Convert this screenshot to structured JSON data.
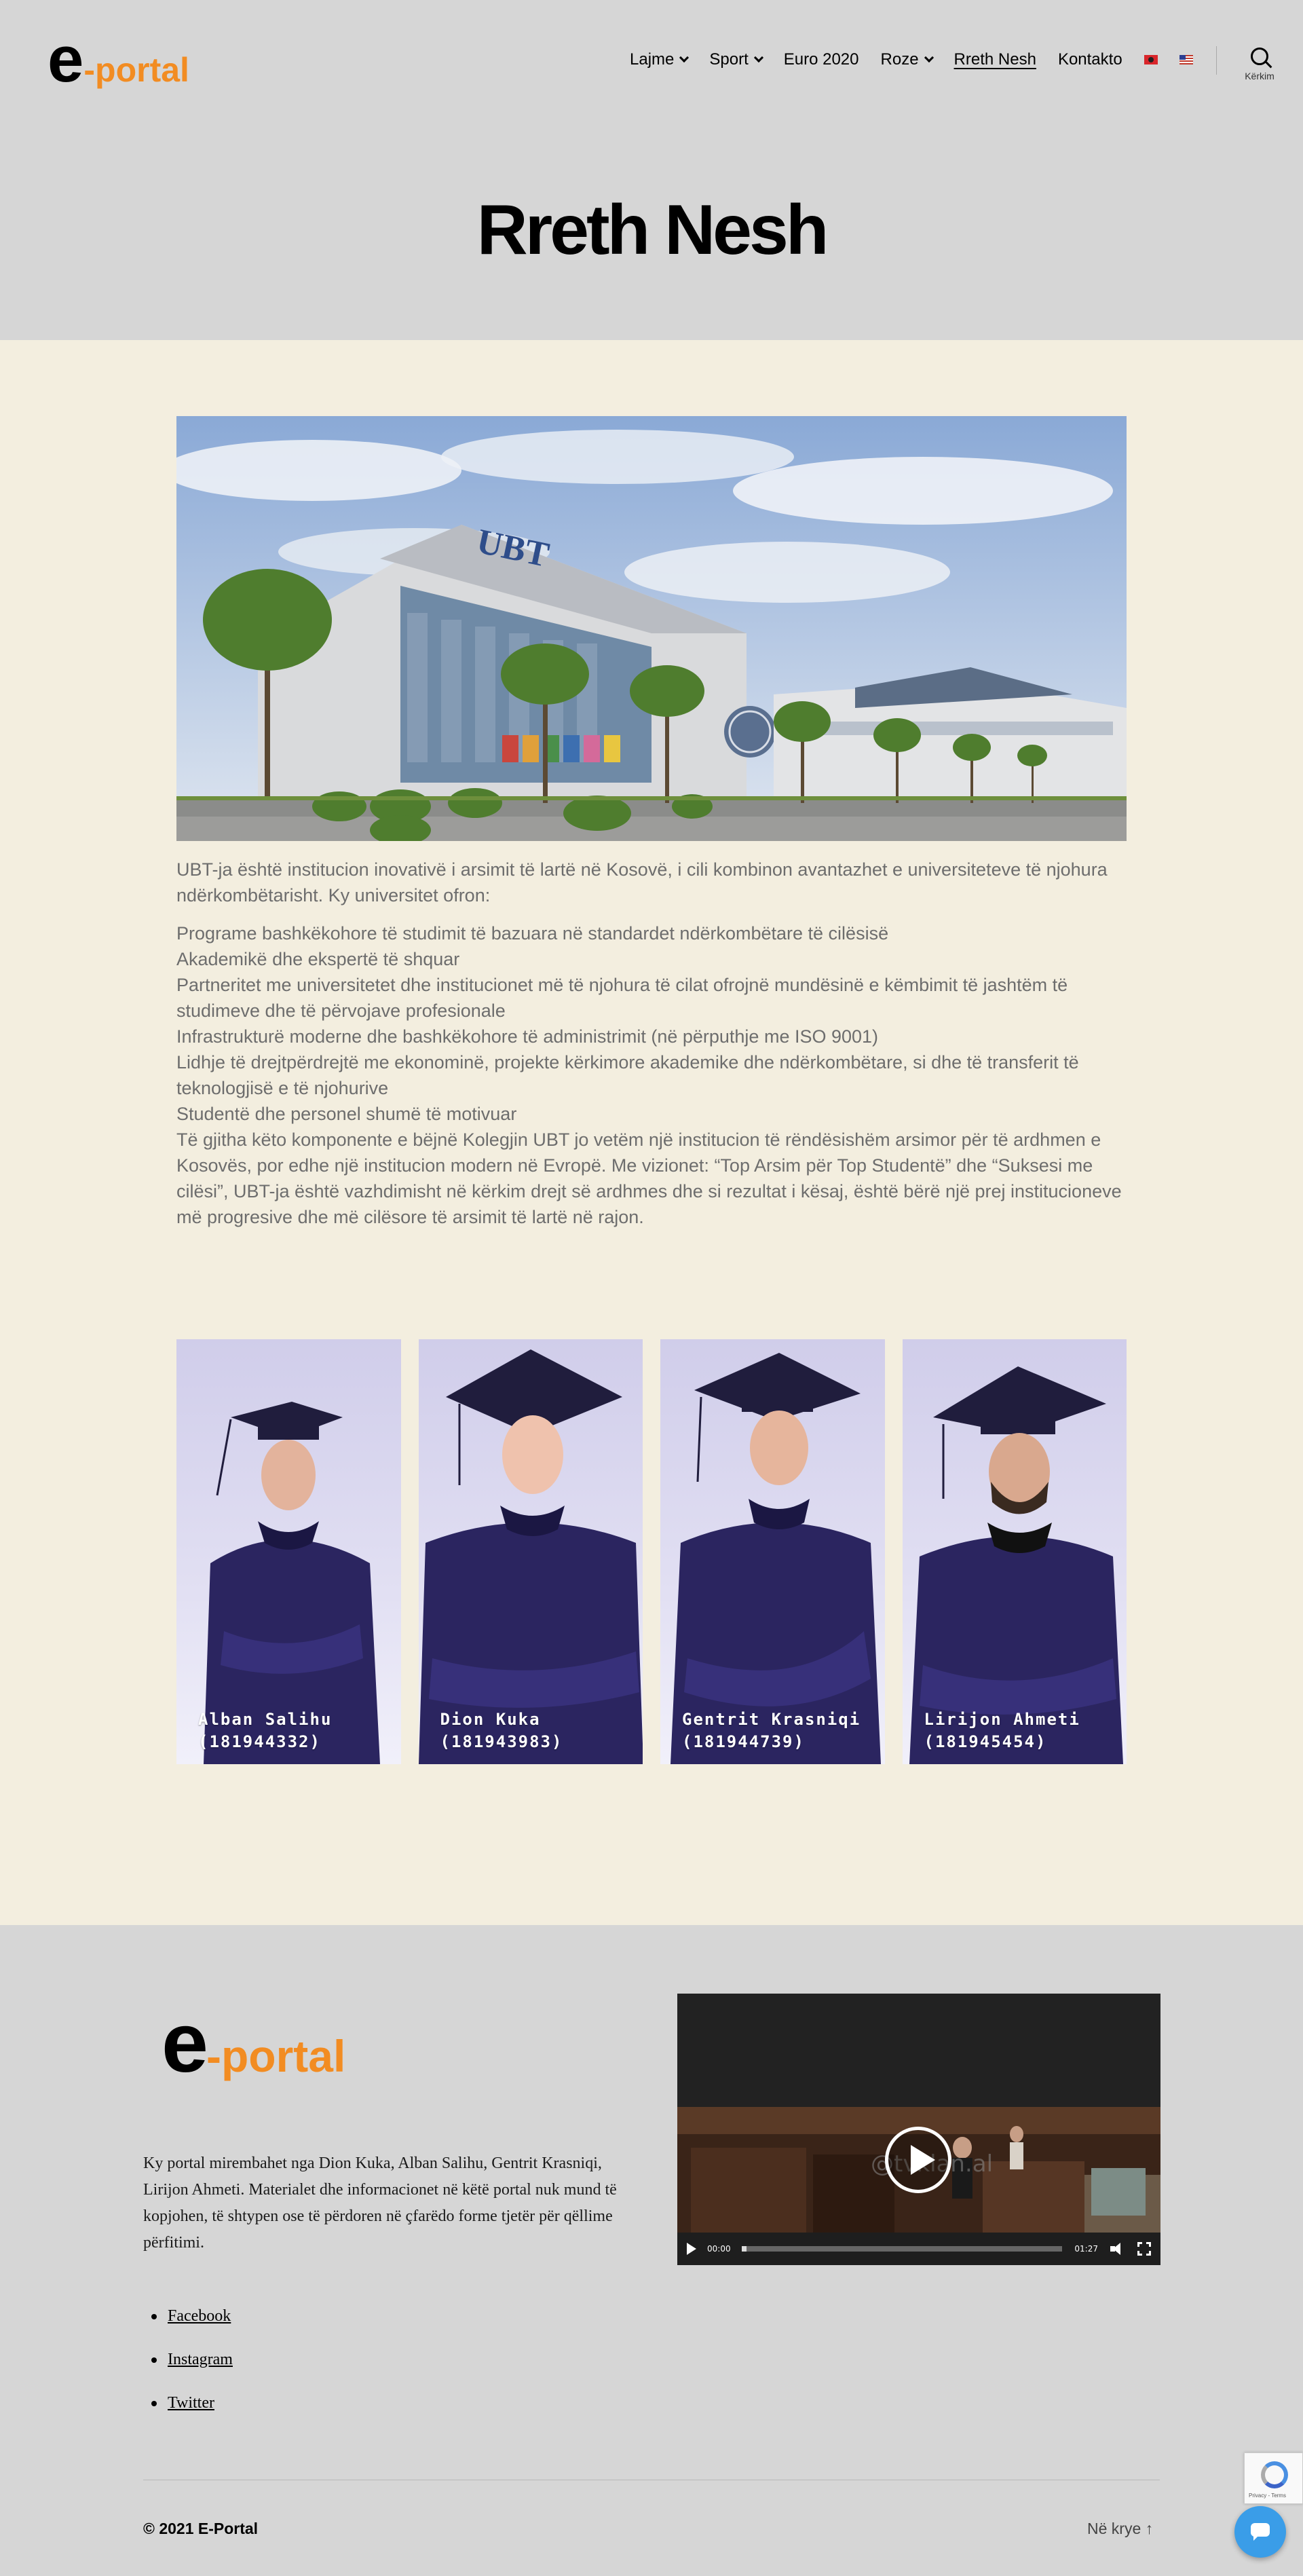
{
  "header": {
    "logo": {
      "e": "e",
      "dash": "-",
      "portal": "portal"
    },
    "nav": [
      {
        "label": "Lajme",
        "has_dropdown": true
      },
      {
        "label": "Sport",
        "has_dropdown": true
      },
      {
        "label": "Euro 2020",
        "has_dropdown": false
      },
      {
        "label": "Roze",
        "has_dropdown": true
      },
      {
        "label": "Rreth Nesh",
        "has_dropdown": false,
        "active": true
      },
      {
        "label": "Kontakto",
        "has_dropdown": false
      }
    ],
    "languages": [
      "albanian-flag-icon",
      "us-flag-icon"
    ],
    "search_label": "Kërkim"
  },
  "page": {
    "title": "Rreth Nesh",
    "hero_image_text": "UBT",
    "intro": "UBT-ja është institucion inovativë i arsimit të lartë në Kosovë, i cili kombinon avantazhet e universiteteve të njohura ndërkombëtarisht. Ky universitet ofron:",
    "points": [
      "Programe bashkëkohore të studimit të bazuara në standardet ndërkombëtare të cilësisë",
      "Akademikë dhe ekspertë të shquar",
      "Partneritet me universitetet dhe institucionet më të njohura të cilat ofrojnë mundësinë e këmbimit të jashtëm të studimeve dhe të përvojave profesionale",
      "Infrastrukturë moderne dhe bashkëkohore të administrimit (në përputhje me ISO 9001)",
      "Lidhje të drejtpërdrejtë me ekonominë, projekte kërkimore akademike dhe ndërkombëtare, si dhe të transferit të teknologjisë e të njohurive",
      "Studentë dhe personel shumë të motivuar",
      "Të gjitha këto komponente e bëjnë Kolegjin UBT jo vetëm një institucion të rëndësishëm arsimor për të ardhmen e Kosovës, por edhe një institucion modern në Evropë. Me vizionet: “Top Arsim për Top Studentë” dhe “Suksesi me cilësi”, UBT-ja është vazhdimisht në kërkim drejt së ardhmes dhe si rezultat i kësaj, është bërë një prej institucioneve më progresive dhe më cilësore të arsimit të lartë në rajon."
    ]
  },
  "students": [
    {
      "name": "Alban Salihu",
      "id": "(181944332)"
    },
    {
      "name": "Dion Kuka",
      "id": "(181943983)"
    },
    {
      "name": "Gentrit Krasniqi",
      "id": "(181944739)"
    },
    {
      "name": "Lirijon Ahmeti",
      "id": "(181945454)"
    }
  ],
  "footer": {
    "logo": {
      "e": "e",
      "dash": "-",
      "portal": "portal"
    },
    "description": "Ky portal mirembahet nga Dion Kuka, Alban Salihu, Gentrit Krasniqi, Lirijon Ahmeti. Materialet dhe informacionet në këtë portal nuk mund të kopjohen, të shtypen ose të përdoren në çfarëdo forme tjetër për qëllime përfitimi.",
    "social": [
      "Facebook",
      "Instagram",
      "Twitter"
    ],
    "video": {
      "watermark": "@tvklan.al",
      "current_time": "00:00",
      "duration": "01:27",
      "progress": 0.0
    },
    "copyright": "© 2021 E-Portal",
    "to_top": "Në krye ↑"
  },
  "widgets": {
    "recaptcha_text": "Privacy - Terms"
  }
}
